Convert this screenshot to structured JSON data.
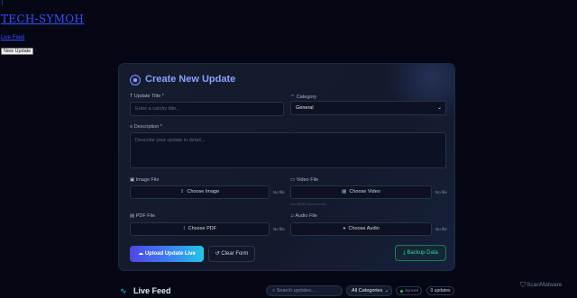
{
  "header": {
    "top_icon": "⁝",
    "site_title": "TECH-SYMOH",
    "live_link": "Live Feed",
    "new_update_button": "New Update"
  },
  "form": {
    "title": "Create New Update",
    "title_label": "Update Title *",
    "title_placeholder": "Enter a catchy title...",
    "category_label": "Category",
    "category_value": "General",
    "description_label": "Description *",
    "description_placeholder": "Describe your update in detail...",
    "image_label": "Image File",
    "image_button": "Choose Image",
    "image_status": "No file",
    "video_label": "Video File",
    "video_button": "Choose Video",
    "video_status": "No file",
    "video_hint": "Max 50MB recommended",
    "pdf_label": "PDF File",
    "pdf_button": "Choose PDF",
    "pdf_status": "No file",
    "audio_label": "Audio File",
    "audio_button": "Choose Audio",
    "audio_status": "No file",
    "upload_button": "Upload Update Live",
    "clear_button": "Clear Form",
    "backup_button": "Backup Data"
  },
  "feed": {
    "title": "Live Feed",
    "search_placeholder": "Search updates...",
    "category_filter": "All Categories",
    "sync_status": "Synced",
    "count": "0 updates"
  },
  "brand": "ScanMalware",
  "colors": {
    "background": "#050814",
    "card": "#151c2e",
    "accent": "#8aa0ff",
    "primary_gradient_start": "#4f46e5",
    "primary_gradient_end": "#22c7e8",
    "success": "#34d399"
  },
  "icons": {
    "card": "plus-circle-icon",
    "title": "text-cursor-icon",
    "category": "tag-icon",
    "description": "align-left-icon",
    "image": "image-icon",
    "video": "video-icon",
    "pdf": "paperclip-icon",
    "audio": "music-icon",
    "upload": "cloud-upload-icon",
    "clear": "rotate-ccw-icon",
    "backup": "download-icon",
    "feed": "activity-icon",
    "brand": "shield-icon"
  }
}
